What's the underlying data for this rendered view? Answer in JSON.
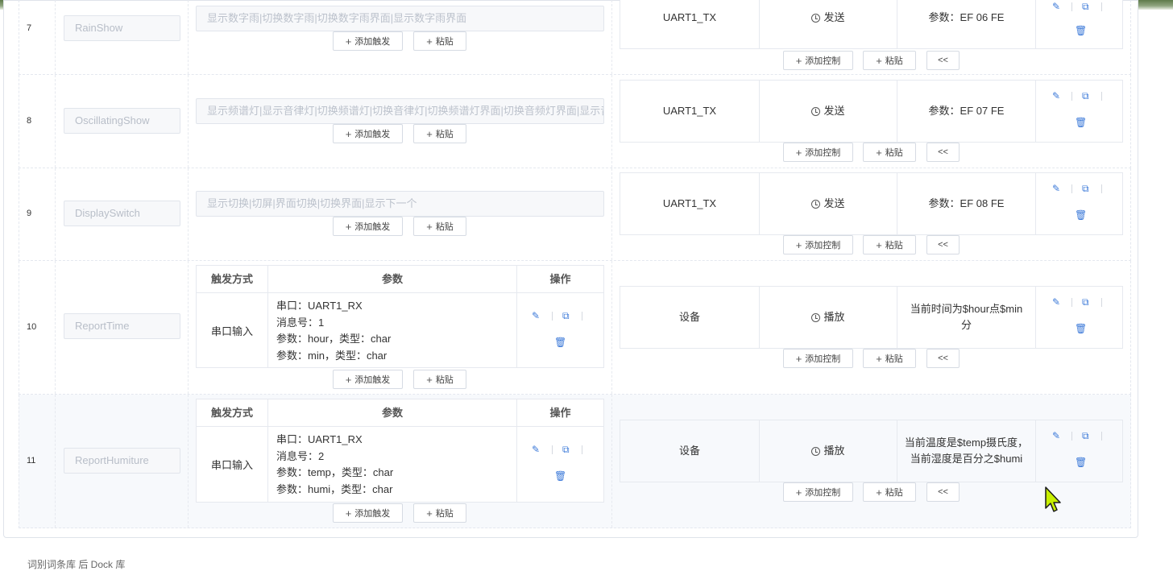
{
  "buttons": {
    "add_trigger": "添加触发",
    "paste": "粘贴",
    "add_control": "添加控制",
    "collapse": "<<"
  },
  "trigger_table_headers": {
    "mode": "触发方式",
    "params": "参数",
    "ops": "操作"
  },
  "rows": [
    {
      "index": "7",
      "name": "RainShow",
      "trigger": "显示数字雨|切换数字雨|切换数字雨界面|显示数字雨界面",
      "control": {
        "target": "UART1_TX",
        "action": "发送",
        "params": "参数：EF 06 FE"
      }
    },
    {
      "index": "8",
      "name": "OscillatingShow",
      "trigger": "显示频谱灯|显示音律灯|切换频谱灯|切换音律灯|切换频谱灯界面|切换音频灯界面|显示音律灯界面",
      "control": {
        "target": "UART1_TX",
        "action": "发送",
        "params": "参数：EF 07 FE"
      }
    },
    {
      "index": "9",
      "name": "DisplaySwitch",
      "trigger": "显示切换|切屏|界面切换|切换界面|显示下一个",
      "control": {
        "target": "UART1_TX",
        "action": "发送",
        "params": "参数：EF 08 FE"
      }
    },
    {
      "index": "10",
      "name": "ReportTime",
      "trigger_detail": {
        "mode": "串口输入",
        "lines": [
          "串口：UART1_RX",
          "消息号：1",
          "参数：hour，类型：char",
          "参数：min，类型：char"
        ]
      },
      "control": {
        "target": "设备",
        "action": "播放",
        "params": "当前时间为$hour点$min分"
      }
    },
    {
      "index": "11",
      "name": "ReportHumiture",
      "trigger_detail": {
        "mode": "串口输入",
        "lines": [
          "串口：UART1_RX",
          "消息号：2",
          "参数：temp，类型：char",
          "参数：humi，类型：char"
        ]
      },
      "control": {
        "target": "设备",
        "action": "播放",
        "params": "当前温度是$temp摄氏度，当前湿度是百分之$humi"
      }
    }
  ],
  "footer": {
    "partial": "词别词条库  后  Dock  库"
  },
  "icons": {
    "edit": "pencil-icon",
    "copy": "copy-icon",
    "delete": "trash-icon",
    "clock": "clock-icon",
    "cursor": "mouse-cursor-icon"
  },
  "colors": {
    "accent": "#3a78d8",
    "cursor": "#c8f000"
  }
}
